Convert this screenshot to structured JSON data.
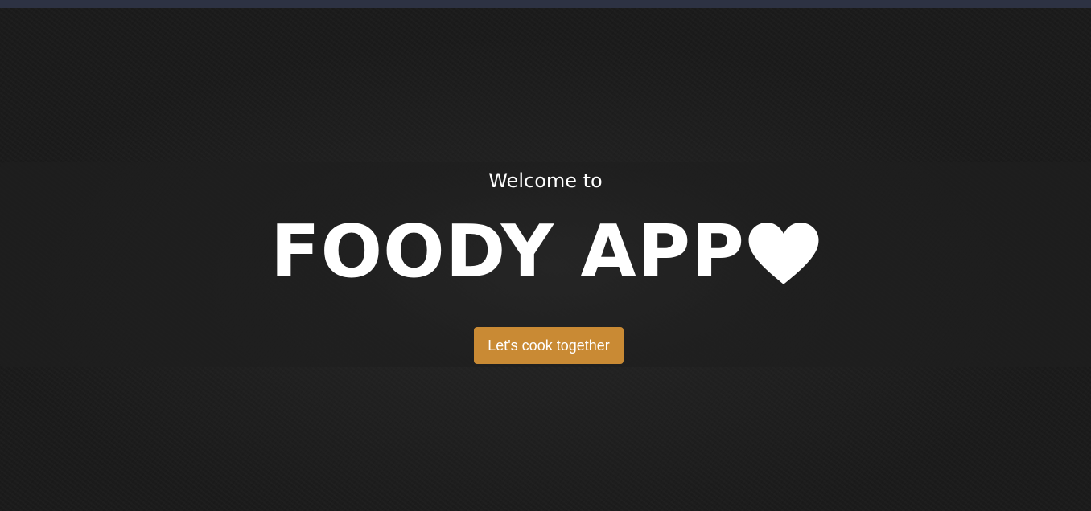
{
  "hero": {
    "welcome_text": "Welcome to",
    "app_title": "FOODY APP",
    "title_icon": "heart-icon",
    "cta_label": "Let's cook together"
  },
  "colors": {
    "top_bar": "#2d3243",
    "background": "#1b1b1b",
    "panel": "#1e1e1e",
    "button": "#c98a34",
    "text": "#ffffff"
  }
}
